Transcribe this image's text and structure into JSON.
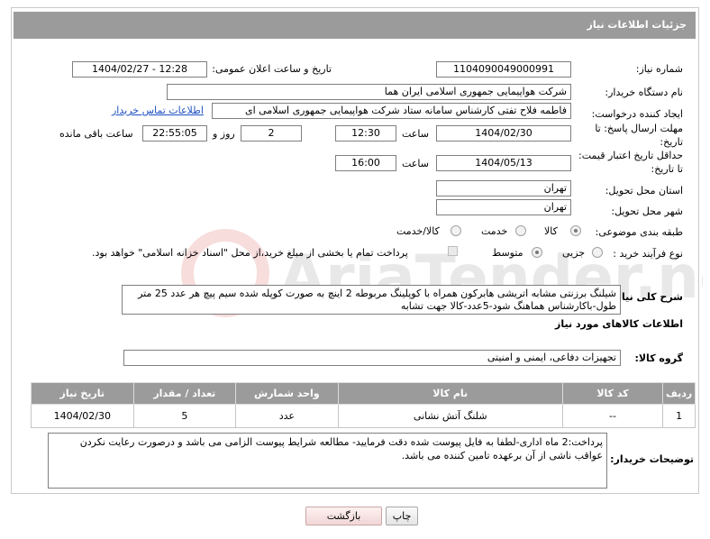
{
  "header": {
    "title": "جزئیات اطلاعات نیاز"
  },
  "fields": {
    "need_number_label": "شماره نیاز:",
    "need_number": "1104090049000991",
    "announce_label": "تاریخ و ساعت اعلان عمومی:",
    "announce_value": "1404/02/27 - 12:28",
    "buyer_org_label": "نام دستگاه خریدار:",
    "buyer_org": "شرکت هواپیمایی جمهوری اسلامی ایران هما",
    "requester_label": "ایجاد کننده درخواست:",
    "requester": "فاطمه فلاح تفتی کارشناس سامانه ستاد شرکت هواپیمایی جمهوری اسلامی ای",
    "buyer_contact_link": "اطلاعات تماس خریدار",
    "reply_deadline_label_1": "مهلت ارسال پاسخ: تا",
    "reply_deadline_label_2": "تاریخ:",
    "reply_date": "1404/02/30",
    "time_label": "ساعت",
    "reply_time": "12:30",
    "days_value": "2",
    "days_and_label": "روز و",
    "remaining_time": "22:55:05",
    "remaining_label": "ساعت باقی مانده",
    "price_validity_label_1": "حداقل تاریخ اعتبار قیمت:",
    "price_validity_label_2": "تا تاریخ:",
    "price_date": "1404/05/13",
    "price_time": "16:00",
    "province_label": "استان محل تحویل:",
    "province": "تهران",
    "city_label": "شهر محل تحویل:",
    "city": "تهران",
    "category_label": "طبقه بندی موضوعی:",
    "category_options": [
      "کالا",
      "خدمت",
      "کالا/خدمت"
    ],
    "category_selected": 0,
    "process_label": "نوع فرآیند خرید :",
    "process_options": [
      "جزیی",
      "متوسط"
    ],
    "process_selected": 1,
    "payment_note": "پرداخت تمام یا بخشی از مبلغ خرید،از محل \"اسناد خزانه اسلامی\" خواهد بود.",
    "general_desc_label": "شرح کلی نیاز:",
    "general_desc": "شیلنگ برزنتی مشابه اتریشی هابرکون همراه با کوپلینگ مربوطه  2 اینچ به صورت کوپله شده سیم پیچ هر عدد 25 متر طول-باکارشناس هماهنگ شود-5عدد-کالا جهت تشابه",
    "goods_info_title": "اطلاعات کالاهای مورد نیاز",
    "goods_group_label": "گروه کالا:",
    "goods_group": "تجهیزات دفاعی، ایمنی و امنیتی",
    "buyer_notes_label": "توضیحات خریدار:",
    "buyer_notes": "پرداخت:2 ماه اداری-لطفا به فایل پیوست شده دقت فرمایید- مطالعه شرایط پیوست الزامی می باشد و درصورت رعایت نکردن عواقب ناشی از آن برعهده تامین کننده می باشد."
  },
  "table": {
    "headers": [
      "ردیف",
      "کد کالا",
      "نام کالا",
      "واحد شمارش",
      "تعداد / مقدار",
      "تاریخ نیاز"
    ],
    "rows": [
      [
        "1",
        "--",
        "شلنگ آتش نشانی",
        "عدد",
        "5",
        "1404/02/30"
      ]
    ]
  },
  "buttons": {
    "print": "چاپ",
    "back": "بازگشت"
  },
  "watermark": {
    "text": "AriaTender.neT"
  },
  "colors": {
    "header_bg": "#9b9b9b",
    "link": "#1f50c4"
  }
}
